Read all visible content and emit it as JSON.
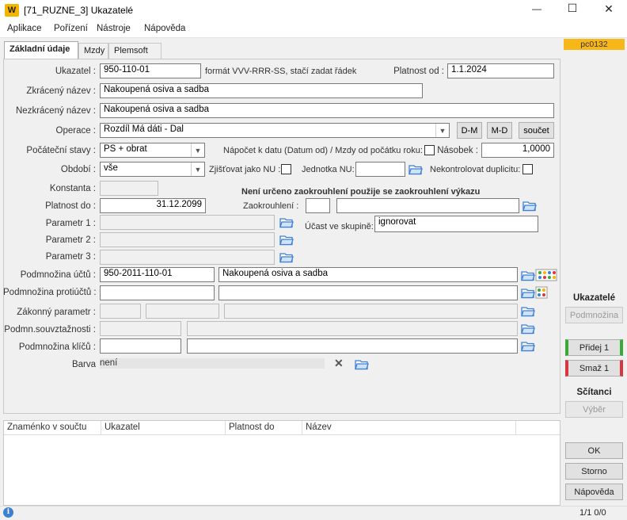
{
  "window": {
    "logo": "W",
    "title": "[71_RUZNE_3] Ukazatelé",
    "minimize_glyph": "—",
    "maximize_glyph": "☐",
    "close_glyph": "✕"
  },
  "menu": [
    "Aplikace",
    "Pořízení",
    "Nástroje",
    "Nápověda"
  ],
  "tabs": [
    "Základní údaje",
    "Mzdy",
    "Plemsoft"
  ],
  "form": {
    "ukazatel_label": "Ukazatel :",
    "ukazatel_value": "950-110-01",
    "format_hint": "formát VVV-RRR-SS, stačí zadat řádek",
    "platnost_od_label": "Platnost od :",
    "platnost_od_value": "1.1.2024",
    "zkraceny_label": "Zkrácený název :",
    "zkraceny_value": "Nakoupená osiva a sadba",
    "nezkraceny_label": "Nezkrácený název :",
    "nezkraceny_value": "Nakoupená osiva a sadba",
    "operace_label": "Operace :",
    "operace_value": "Rozdíl Má dáti - Dal",
    "btn_dm": "D-M",
    "btn_md": "M-D",
    "btn_soucet": "součet",
    "pocatecni_label": "Počáteční stavy :",
    "pocatecni_value": "PS + obrat",
    "napocet_label": "Nápočet k datu (Datum od) / Mzdy od počátku roku:",
    "nasobek_label": "Násobek :",
    "nasobek_value": "1,0000",
    "obdobi_label": "Období :",
    "obdobi_value": "vše",
    "zjistovat_label": "Zjišťovat jako NU :",
    "jednotka_label": "Jednotka NU:",
    "nekontrolovat_label": "Nekontrolovat duplicitu:",
    "konstanta_label": "Konstanta :",
    "zaokrouhleni_note": "Není určeno zaokrouhlení použije se zaokrouhlení výkazu",
    "platnost_do_label": "Platnost do :",
    "platnost_do_value": "31.12.2099",
    "zaokrouhleni_label": "Zaokrouhlení :",
    "parametr1_label": "Parametr 1 :",
    "parametr2_label": "Parametr 2 :",
    "parametr3_label": "Parametr 3 :",
    "ucast_label": "Účast ve skupině:",
    "ucast_value": "ignorovat",
    "podmnozina_uctu_label": "Podmnožina účtů :",
    "podmnozina_uctu_code": "950-2011-110-01",
    "podmnozina_uctu_name": "Nakoupená osiva a sadba",
    "podmnozina_protiuctu_label": "Podmnožina protiúčtů :",
    "zakonny_label": "Zákonný parametr :",
    "podmn_souvz_label": "Podmn.souvztažnosti :",
    "podmnozina_klicu_label": "Podmnožina klíčů :",
    "barva_label": "Barva",
    "barva_value": "není"
  },
  "grid": {
    "columns": [
      "Znaménko v součtu",
      "Ukazatel",
      "Platnost do",
      "Název"
    ]
  },
  "right_panel": {
    "badge": "pc0132",
    "ukazatele_title": "Ukazatelé",
    "podmnozina_btn": "Podmnožina",
    "pridej_btn": "Přidej 1",
    "smaz_btn": "Smaž 1",
    "scitanci_title": "Sčítanci",
    "vyber_btn": "Výběr",
    "ok_btn": "OK",
    "storno_btn": "Storno",
    "napoveda_btn": "Nápověda"
  },
  "status": {
    "info_icon": "i",
    "counter": "1/1 0/0"
  },
  "colors": {
    "badge_bg": "#f7b718",
    "pridej_accent": "#3aa935",
    "smaz_accent": "#d9363e",
    "folder": "#3d7fd1"
  }
}
